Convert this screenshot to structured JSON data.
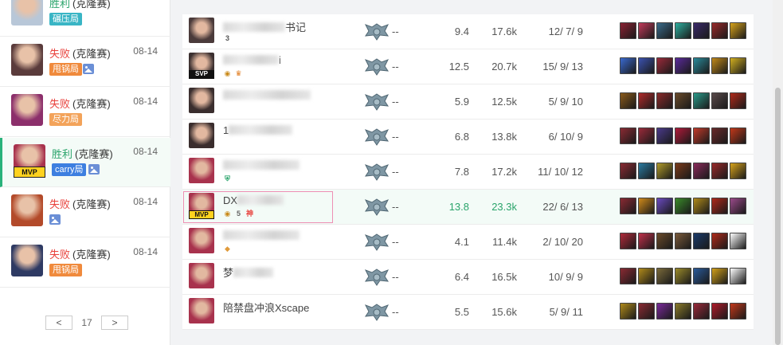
{
  "history": {
    "matches": [
      {
        "result": "胜利",
        "mode": "(克隆赛)",
        "date": "",
        "tag": "碾压局",
        "tag_color": "#39b5c5",
        "outcome": "win",
        "hero": "#b8c7d8",
        "mvp": ""
      },
      {
        "result": "失败",
        "mode": "(克隆赛)",
        "date": "08-14",
        "tag": "甩锅局",
        "tag_color": "#f08a3c",
        "outcome": "lose",
        "hero": "#5a3b3b",
        "mvp": ""
      },
      {
        "result": "失败",
        "mode": "(克隆赛)",
        "date": "08-14",
        "tag": "尽力局",
        "tag_color": "#f3a35a",
        "outcome": "lose",
        "hero": "#8c2f6b",
        "mvp": ""
      },
      {
        "result": "胜利",
        "mode": "(克隆赛)",
        "date": "08-14",
        "tag": "carry局",
        "tag_color": "#3d7fe0",
        "outcome": "win",
        "hero": "#a8324d",
        "mvp": "MVP"
      },
      {
        "result": "失败",
        "mode": "(克隆赛)",
        "date": "08-14",
        "tag": "",
        "tag_color": "",
        "outcome": "lose",
        "hero": "#b34a2a",
        "mvp": ""
      },
      {
        "result": "失败",
        "mode": "(克隆赛)",
        "date": "08-14",
        "tag": "甩锅局",
        "tag_color": "#f08a3c",
        "outcome": "lose",
        "hero": "#2e3a63",
        "mvp": ""
      }
    ],
    "pager": {
      "prev": "<",
      "page": "17",
      "next": ">"
    }
  },
  "scoreboard": {
    "rows": [
      {
        "name": "书记",
        "badge": "",
        "icons": [
          "3"
        ],
        "rank": "--",
        "n1": "9.4",
        "n2": "17.6k",
        "kda": "12/ 7/ 9",
        "hero": "#4a3a3a",
        "items": [
          "#8a2233",
          "#c23a5a",
          "#3a6b8a",
          "#2fb0a0",
          "#3a2a6a",
          "#9a2a2a",
          "#d7a21a"
        ]
      },
      {
        "name": "i",
        "badge": "SVP",
        "icons": [
          "◉",
          "♛"
        ],
        "rank": "--",
        "n1": "12.5",
        "n2": "20.7k",
        "kda": "15/ 9/ 13",
        "hero": "#3c3030",
        "items": [
          "#3a6ad0",
          "#3b52b0",
          "#9a2a3a",
          "#5a2a9a",
          "#2a8a9a",
          "#c28a1a",
          "#d2b020"
        ]
      },
      {
        "name": "",
        "badge": "",
        "icons": [],
        "rank": "--",
        "n1": "5.9",
        "n2": "12.5k",
        "kda": "5/ 9/ 10",
        "hero": "#3a2e2e",
        "items": [
          "#8a5a1a",
          "#b02a2a",
          "#8a2a2a",
          "#6a4a2a",
          "#2a9a8a",
          "#5a4a4a",
          "#b02a1a"
        ]
      },
      {
        "name": "1",
        "badge": "",
        "icons": [],
        "rank": "--",
        "n1": "6.8",
        "n2": "13.8k",
        "kda": "6/ 10/ 9",
        "hero": "#3a2d2d",
        "items": [
          "#8a2a33",
          "#9a2a3a",
          "#4a3a8a",
          "#b01a3a",
          "#c23a2a",
          "#6a2a2a",
          "#c2381a"
        ]
      },
      {
        "name": "",
        "badge": "",
        "icons": [
          "⛨"
        ],
        "rank": "--",
        "n1": "7.8",
        "n2": "17.2k",
        "kda": "11/ 10/ 12",
        "hero": "#a8324d",
        "items": [
          "#8a2a33",
          "#2a7aa0",
          "#b09a2a",
          "#7a3a1a",
          "#8a2a5a",
          "#9a2a2a",
          "#d7a21a"
        ]
      },
      {
        "name": "DX",
        "badge": "MVP",
        "icons": [
          "◉",
          "5",
          "神"
        ],
        "rank": "--",
        "n1": "13.8",
        "n2": "23.3k",
        "kda": "22/ 6/ 13",
        "hero": "#a8324d",
        "items": [
          "#8a2a33",
          "#d08a1a",
          "#6a4ac0",
          "#3a8a2a",
          "#b08a1a",
          "#b02a1a",
          "#9a4a8a"
        ]
      },
      {
        "name": "",
        "badge": "",
        "icons": [
          "◆"
        ],
        "rank": "--",
        "n1": "4.1",
        "n2": "11.4k",
        "kda": "2/ 10/ 20",
        "hero": "#a8324d",
        "items": [
          "#b02a3a",
          "#c0304a",
          "#6a4a2a",
          "#7a5a3a",
          "#1a3a6a",
          "#b02a1a",
          "#ffffff"
        ]
      },
      {
        "name": "梦",
        "badge": "",
        "icons": [],
        "rank": "--",
        "n1": "6.4",
        "n2": "16.5k",
        "kda": "10/ 9/ 9",
        "hero": "#a8324d",
        "items": [
          "#8a2a33",
          "#b08a1a",
          "#7a6a3a",
          "#9a8a2a",
          "#2a5a9a",
          "#d2a01a",
          "#ffffff"
        ]
      },
      {
        "name": "陪禁盘冲浪Xscape",
        "badge": "",
        "icons": [],
        "rank": "--",
        "n1": "5.5",
        "n2": "15.6k",
        "kda": "5/ 9/ 11",
        "hero": "#a8324d",
        "items": [
          "#b08a1a",
          "#8a2a33",
          "#7a2a9a",
          "#8a7a2a",
          "#9a2a3a",
          "#b01a2a",
          "#c2381a"
        ]
      }
    ]
  }
}
